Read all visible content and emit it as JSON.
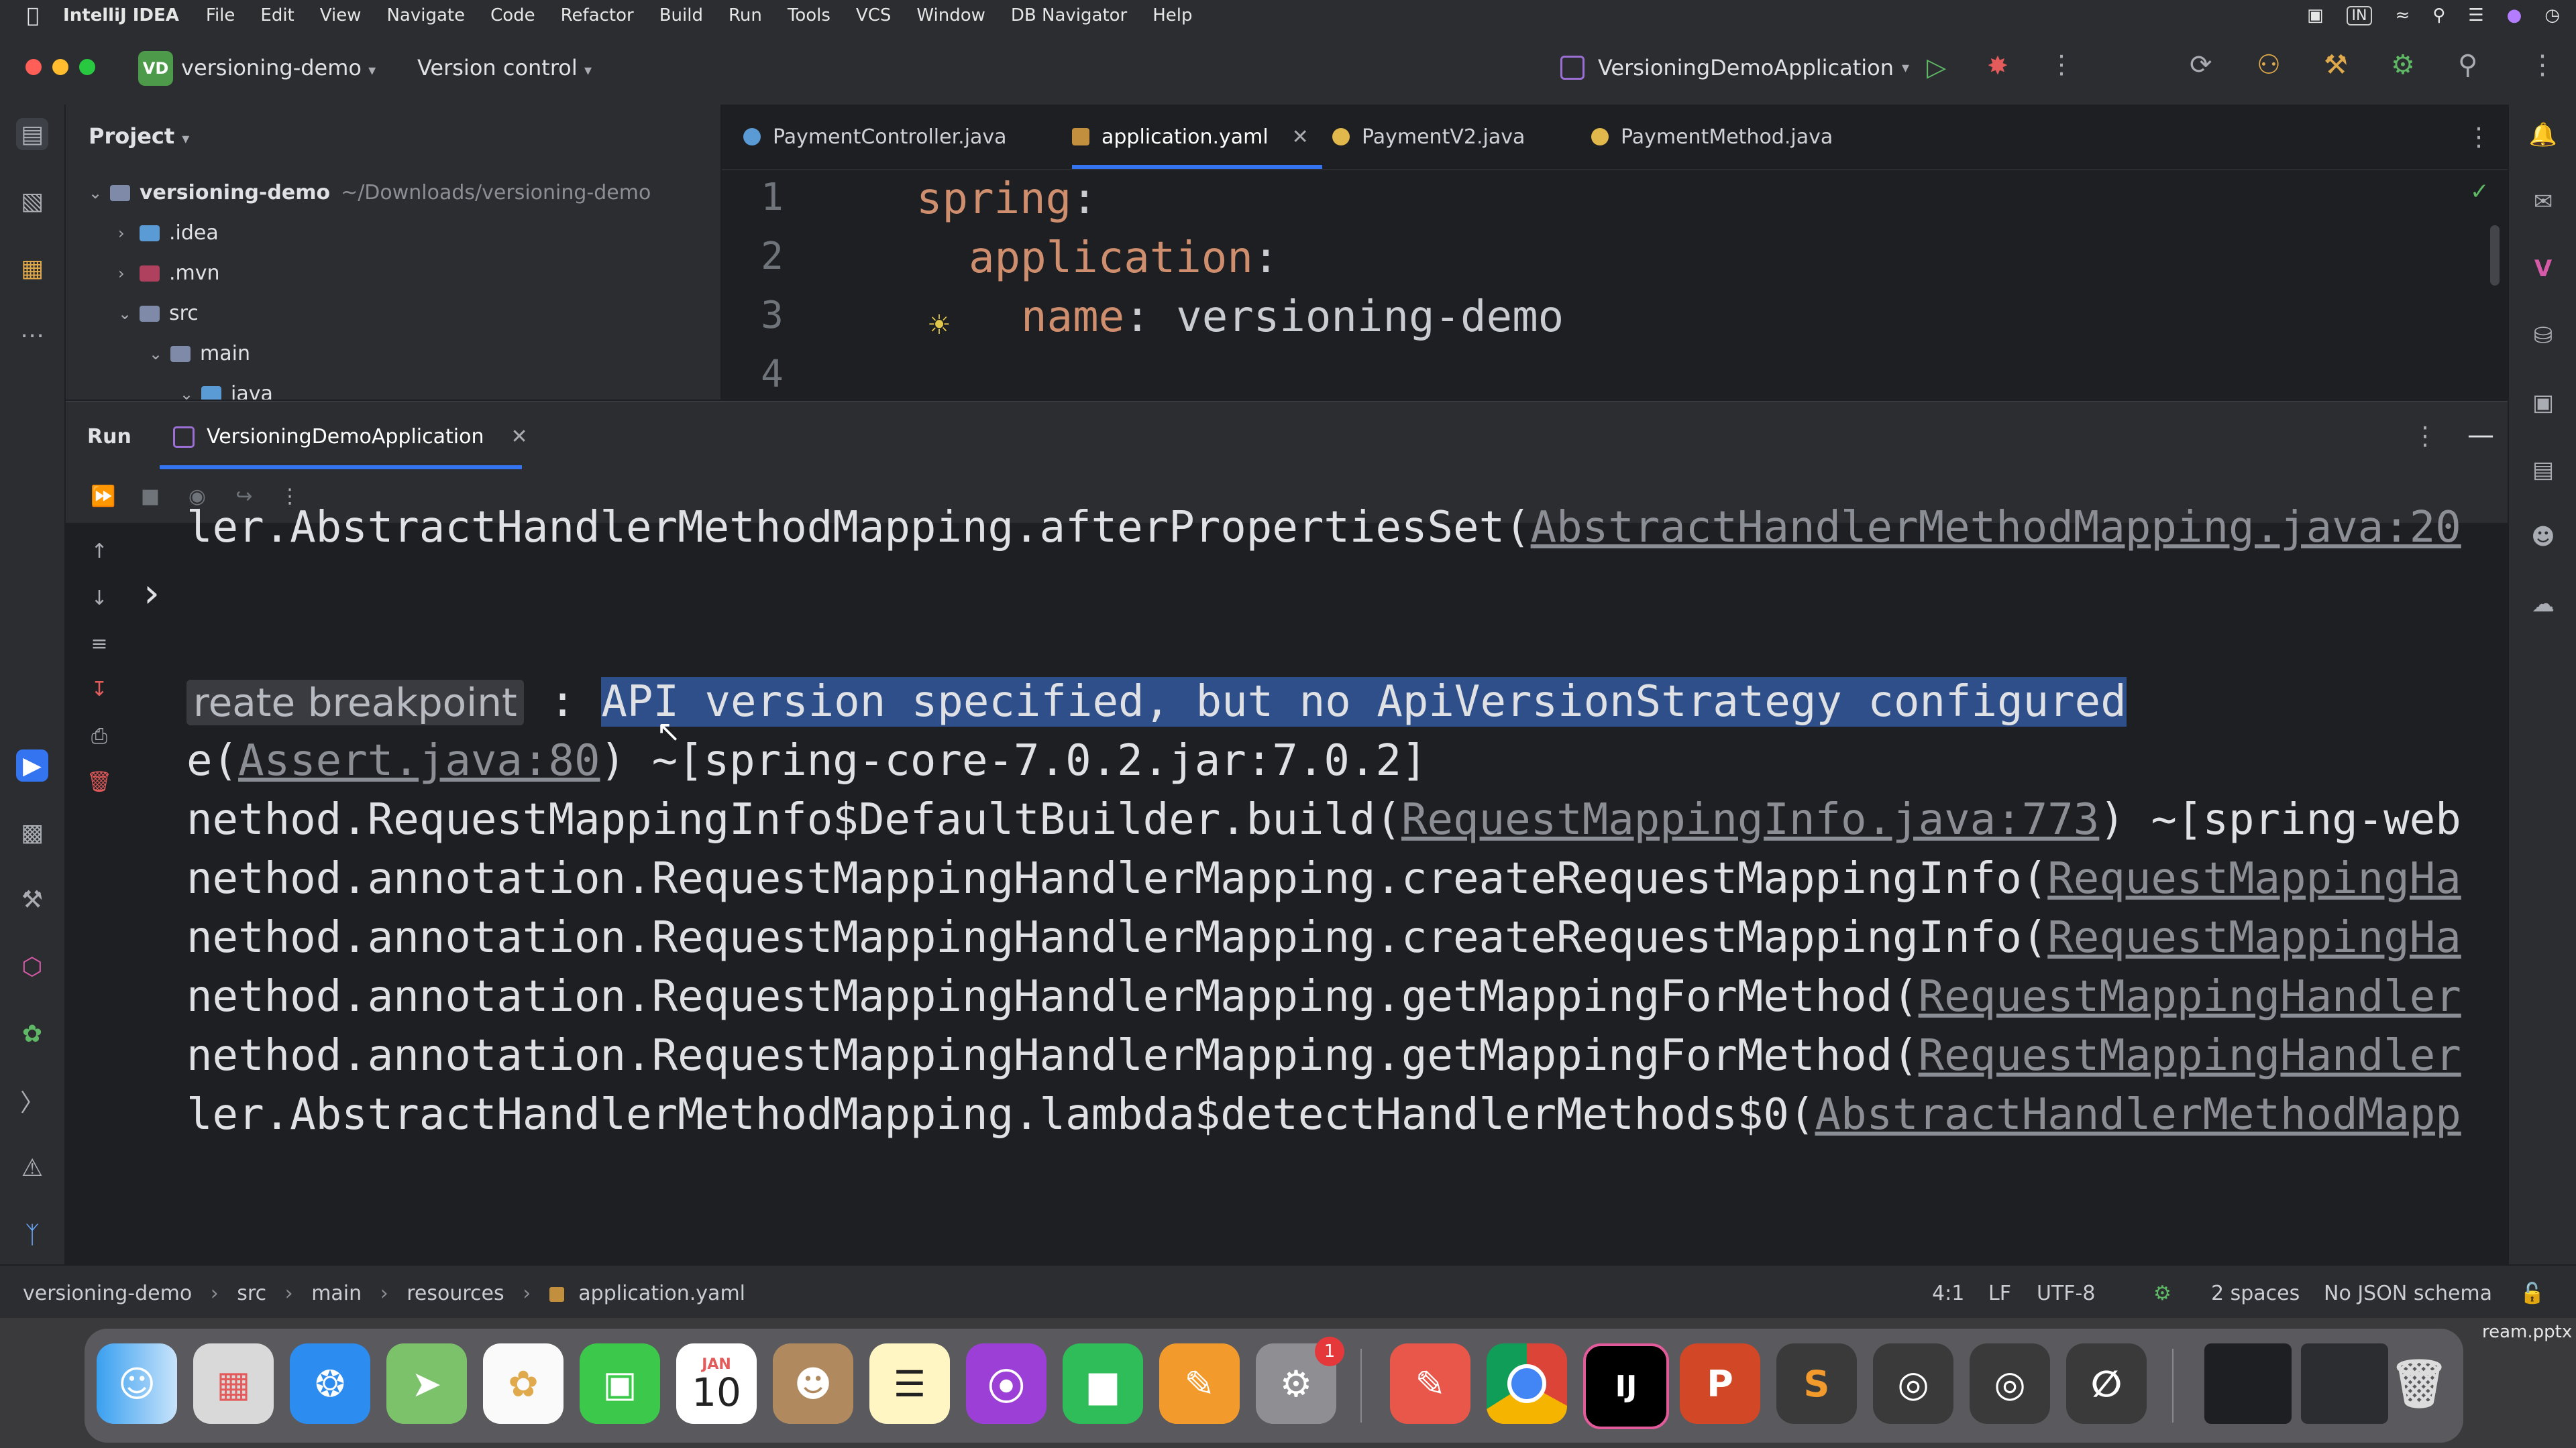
{
  "menubar": {
    "app_name": "IntelliJ IDEA",
    "items": [
      "File",
      "Edit",
      "View",
      "Navigate",
      "Code",
      "Refactor",
      "Build",
      "Run",
      "Tools",
      "VCS",
      "Window",
      "DB Navigator",
      "Help"
    ],
    "input_indicator": "IN"
  },
  "titlebar": {
    "project_badge": "VD",
    "project_name": "versioning-demo",
    "version_control": "Version control",
    "run_config": "VersioningDemoApplication"
  },
  "project_panel": {
    "title": "Project",
    "tree": [
      {
        "label": "versioning-demo",
        "detail": "~/Downloads/versioning-demo"
      },
      {
        "label": ".idea"
      },
      {
        "label": ".mvn"
      },
      {
        "label": "src"
      },
      {
        "label": "main"
      },
      {
        "label": "java"
      }
    ]
  },
  "editor": {
    "tabs": [
      "PaymentController.java",
      "application.yaml",
      "PaymentV2.java",
      "PaymentMethod.java"
    ],
    "line_numbers": [
      "1",
      "2",
      "3",
      "4"
    ],
    "lines": {
      "l1_key": "spring",
      "l2_key": "application",
      "l3_key": "name",
      "l3_value": "versioning-demo"
    }
  },
  "run_panel": {
    "label": "Run",
    "tab": "VersioningDemoApplication",
    "console": {
      "line0_text": "ler.AbstractHandlerMethodMapping.afterPropertiesSet(",
      "line0_link": "AbstractHandlerMethodMapping.java:20",
      "tooltip": "reate breakpoint",
      "line1_sep": " : ",
      "line1_selected": "API version specified, but no ApiVersionStrategy configured",
      "line2_pre": "e(",
      "line2_link": "Assert.java:80",
      "line2_post": ") ~[spring-core-7.0.2.jar:7.0.2]",
      "line3_text": "nethod.RequestMappingInfo$DefaultBuilder.build(",
      "line3_link": "RequestMappingInfo.java:773",
      "line3_post": ") ~[spring-web",
      "line4_text": "nethod.annotation.RequestMappingHandlerMapping.createRequestMappingInfo(",
      "line4_link": "RequestMappingHa",
      "line5_text": "nethod.annotation.RequestMappingHandlerMapping.createRequestMappingInfo(",
      "line5_link": "RequestMappingHa",
      "line6_text": "nethod.annotation.RequestMappingHandlerMapping.getMappingForMethod(",
      "line6_link": "RequestMappingHandler",
      "line7_text": "nethod.annotation.RequestMappingHandlerMapping.getMappingForMethod(",
      "line7_link": "RequestMappingHandler",
      "line8_text": "ler.AbstractHandlerMethodMapping.lambda$detectHandlerMethods$0(",
      "line8_link": "AbstractHandlerMethodMapp"
    }
  },
  "statusbar": {
    "breadcrumb": [
      "versioning-demo",
      "src",
      "main",
      "resources",
      "application.yaml"
    ],
    "position": "4:1",
    "line_sep": "LF",
    "encoding": "UTF-8",
    "indent": "2 spaces",
    "schema": "No JSON schema"
  },
  "dock": {
    "calendar_month": "JAN",
    "calendar_day": "10",
    "settings_badge": "1",
    "intellij_label": "IJ",
    "desktop_file": "ream.pptx"
  },
  "colors": {
    "accent": "#3574f0",
    "yaml_key": "#cf8e6d",
    "selection": "#2e4f8a"
  }
}
